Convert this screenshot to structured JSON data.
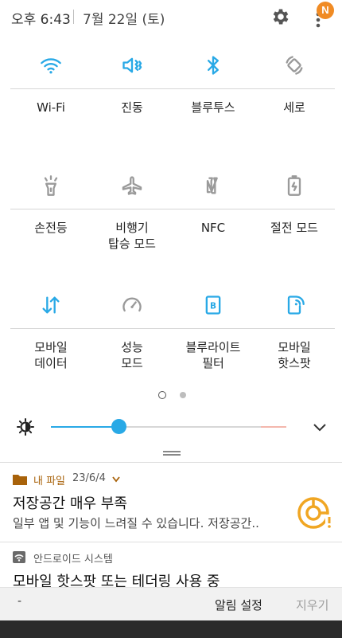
{
  "status_bar": {
    "time": "오후 6:43",
    "date": "7월 22일 (토)",
    "badge": "N"
  },
  "tiles": [
    {
      "icon": "wifi-icon",
      "label": [
        "Wi-Fi"
      ],
      "active": true
    },
    {
      "icon": "vibrate-icon",
      "label": [
        "진동"
      ],
      "active": true
    },
    {
      "icon": "bluetooth-icon",
      "label": [
        "블루투스"
      ],
      "active": true
    },
    {
      "icon": "rotate-icon",
      "label": [
        "세로"
      ],
      "active": false
    },
    {
      "icon": "flashlight-icon",
      "label": [
        "손전등"
      ],
      "active": false
    },
    {
      "icon": "airplane-icon",
      "label": [
        "비행기",
        "탑승 모드"
      ],
      "active": false
    },
    {
      "icon": "nfc-icon",
      "label": [
        "NFC"
      ],
      "active": false
    },
    {
      "icon": "power-saving-icon",
      "label": [
        "절전 모드"
      ],
      "active": false
    },
    {
      "icon": "mobile-data-icon",
      "label": [
        "모바일",
        "데이터"
      ],
      "active": true
    },
    {
      "icon": "performance-icon",
      "label": [
        "성능",
        "모드"
      ],
      "active": false
    },
    {
      "icon": "blue-light-filter-icon",
      "label": [
        "블루라이트",
        "필터"
      ],
      "active": true
    },
    {
      "icon": "mobile-hotspot-icon",
      "label": [
        "모바일",
        "핫스팟"
      ],
      "active": true
    }
  ],
  "pages": {
    "current": 1,
    "total": 2
  },
  "brightness": {
    "level": 0.29
  },
  "notifications": [
    {
      "app": "내 파일",
      "time": "23/6/4",
      "title": "저장공간 매우 부족",
      "text": "일부 앱 및 기능이 느려질 수 있습니다. 저장공간..",
      "app_color": "#a8620a"
    },
    {
      "app": "안드로이드 시스템",
      "title": "모바일 핫스팟 또는 테더링 사용 중",
      "app_color": "#555555"
    }
  ],
  "bottom_bar": {
    "left_mark": "-",
    "settings_label": "알림 설정",
    "clear_label": "지우기"
  },
  "colors": {
    "active": "#29a9e6",
    "inactive": "#9a9a9a",
    "badge": "#f08b24",
    "storage_warning": "#f0a623"
  }
}
